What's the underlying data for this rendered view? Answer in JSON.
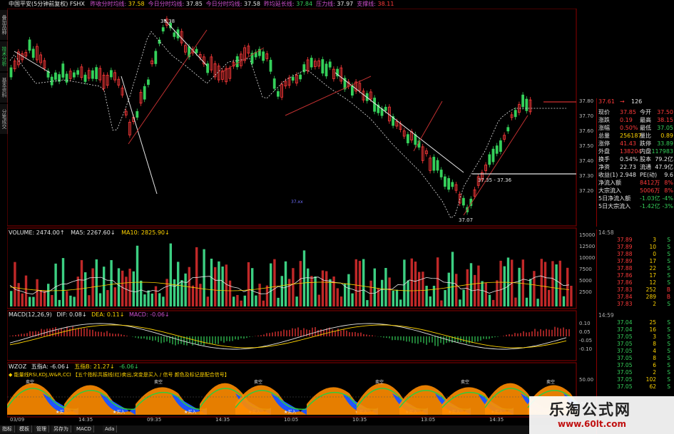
{
  "header": {
    "title": "中国平安(5分钟前复权) FSHX",
    "items": [
      {
        "label": "昨收分时均线",
        "value": "37.58",
        "color": "#ffd400"
      },
      {
        "label": "今日分时均线",
        "value": "37.85",
        "color": "#e6e6e6"
      },
      {
        "label": "今日分时均线",
        "value": "37.58",
        "color": "#e6e6e6"
      },
      {
        "label": "昨均延长线",
        "value": "37.84",
        "color": "#35d05a"
      },
      {
        "label": "压力线",
        "value": "37.97",
        "color": "#e6e6e6"
      },
      {
        "label": "支撑线",
        "value": "38.11",
        "color": "#ff3a3a"
      }
    ]
  },
  "side_tabs": [
    "叠加品种",
    "技术分析",
    "基本资料",
    "分笔成交"
  ],
  "price_chart": {
    "high_label": "38.38",
    "low_label": "37.07",
    "level_label": "37.35 - 37.36",
    "center_tag": "37.xx"
  },
  "price_axis": [
    "37.80",
    "37.70",
    "37.60",
    "37.50",
    "37.40",
    "37.30",
    "37.20"
  ],
  "quote_top": {
    "price": "37.61",
    "arrow": "→",
    "vol": "126"
  },
  "quote_rows": [
    {
      "k": "现价",
      "v": "37.85",
      "k2": "今开",
      "v2": "37.50",
      "c1": "#ff3a3a",
      "c2": "#ff3a3a"
    },
    {
      "k": "涨跌",
      "v": "0.19",
      "k2": "最高",
      "v2": "38.15",
      "c1": "#ff3a3a",
      "c2": "#ff3a3a"
    },
    {
      "k": "涨幅",
      "v": "0.50%",
      "k2": "最低",
      "v2": "37.05",
      "c1": "#ff3a3a",
      "c2": "#35d05a"
    },
    {
      "k": "总量",
      "v": "256187",
      "k2": "量比",
      "v2": "0.89",
      "c1": "#ffd400",
      "c2": "#ffd400"
    },
    {
      "k": "涨停",
      "v": "41.43",
      "k2": "跌停",
      "v2": "33.89",
      "c1": "#ff3a3a",
      "c2": "#35d05a"
    },
    {
      "k": "外盘",
      "v": "138204",
      "k2": "内盘",
      "v2": "117983",
      "c1": "#ff3a3a",
      "c2": "#35d05a"
    },
    {
      "k": "换手",
      "v": "0.54%",
      "k2": "股本",
      "v2": "79.2亿",
      "c1": "#e6e6e6",
      "c2": "#e6e6e6"
    },
    {
      "k": "净资",
      "v": "22.73",
      "k2": "流通",
      "v2": "47.9亿",
      "c1": "#e6e6e6",
      "c2": "#e6e6e6"
    },
    {
      "k": "收益(1)",
      "v": "2.948",
      "k2": "PE(动)",
      "v2": "9.6",
      "c1": "#e6e6e6",
      "c2": "#e6e6e6"
    }
  ],
  "flow_rows": [
    {
      "k": "净流入额",
      "v": "8412万",
      "p": "8%",
      "c": "#ff3a3a"
    },
    {
      "k": "大宗流入",
      "v": "5006万",
      "p": "8%",
      "c": "#ff3a3a"
    },
    {
      "k": "5日净流入额",
      "v": "-1.03亿",
      "p": "-4%",
      "c": "#35d05a"
    },
    {
      "k": "5日大宗流入",
      "v": "-1.42亿",
      "p": "-3%",
      "c": "#35d05a"
    }
  ],
  "ticks1": {
    "time": "14:58",
    "rows": [
      {
        "p": "37.89",
        "q": "3",
        "a": "S",
        "c": "#ff3a3a"
      },
      {
        "p": "37.89",
        "q": "10",
        "a": "S",
        "c": "#ff3a3a"
      },
      {
        "p": "37.88",
        "q": "0",
        "a": "S",
        "c": "#ff3a3a"
      },
      {
        "p": "37.89",
        "q": "17",
        "a": "S",
        "c": "#ff3a3a"
      },
      {
        "p": "37.88",
        "q": "22",
        "a": "S",
        "c": "#ff3a3a"
      },
      {
        "p": "37.86",
        "q": "17",
        "a": "S",
        "c": "#ff3a3a"
      },
      {
        "p": "37.86",
        "q": "12",
        "a": "S",
        "c": "#ff3a3a"
      },
      {
        "p": "37.83",
        "q": "252",
        "a": "B",
        "c": "#ff3a3a"
      },
      {
        "p": "37.84",
        "q": "289",
        "a": "B",
        "c": "#ff3a3a"
      },
      {
        "p": "37.83",
        "q": "2",
        "a": "S",
        "c": "#ff3a3a"
      }
    ]
  },
  "ticks2": {
    "time": "14:59",
    "rows": [
      {
        "p": "37.04",
        "q": "25",
        "a": "S",
        "c": "#35d05a"
      },
      {
        "p": "37.04",
        "q": "16",
        "a": "S",
        "c": "#35d05a"
      },
      {
        "p": "37.05",
        "q": "3",
        "a": "S",
        "c": "#35d05a"
      },
      {
        "p": "37.05",
        "q": "8",
        "a": "S",
        "c": "#35d05a"
      },
      {
        "p": "37.05",
        "q": "4",
        "a": "S",
        "c": "#35d05a"
      },
      {
        "p": "37.05",
        "q": "8",
        "a": "S",
        "c": "#35d05a"
      },
      {
        "p": "37.05",
        "q": "6",
        "a": "S",
        "c": "#35d05a"
      },
      {
        "p": "37.05",
        "q": "2",
        "a": "S",
        "c": "#35d05a"
      },
      {
        "p": "37.05",
        "q": "102",
        "a": "S",
        "c": "#35d05a"
      },
      {
        "p": "37.05",
        "q": "62",
        "a": "S",
        "c": "#35d05a"
      }
    ]
  },
  "volume_header": {
    "title": "VOLUME: 2474.00↑",
    "ma5": "MA5: 2267.60↓",
    "ma10": "MA10: 2825.90↓"
  },
  "volume_axis": [
    "15000",
    "12500",
    "10000",
    "7500",
    "5000",
    "2500"
  ],
  "macd_header": {
    "title": "MACD(12,26,9)",
    "dif": "DIF: 0.08↓",
    "dea": "DEA: 0.11↓",
    "macd": "MACD: -0.06↓"
  },
  "macd_axis": [
    "0.10",
    "0.05",
    "-0.05",
    "-0.10"
  ],
  "wzoz_header": {
    "title": "WZOZ",
    "a": "五指A: -6.06↓",
    "b": "五指B: 21.27↓",
    "c": "-6.06↓"
  },
  "wzoz_note": "◆ 能量线RSI,KDJ,W&R,CCI 【五个指标共振线(红)卖出,突变是买入 / 信号 颜色及标记是配合信号】",
  "wzoz_axis": [
    "50.00",
    "-50.00"
  ],
  "wzoz_labels": {
    "buy": "买入",
    "sell": "卖空"
  },
  "time_axis": [
    "03/09",
    "14:35",
    "09:35",
    "14:35",
    "10:05",
    "10:35",
    "13:05",
    "14:35"
  ],
  "bottom_tabs": [
    "指标",
    "模板",
    "管理",
    "另存为",
    "MACD",
    "Ada"
  ],
  "watermark": {
    "line1": "乐淘公式网",
    "line2": "www.60lt.com"
  },
  "colors": {
    "up": "#ff3a3a",
    "down": "#35d05a",
    "volume_up": "#d03030",
    "volume_down": "#3ccf82",
    "grid": "#8b0000"
  }
}
